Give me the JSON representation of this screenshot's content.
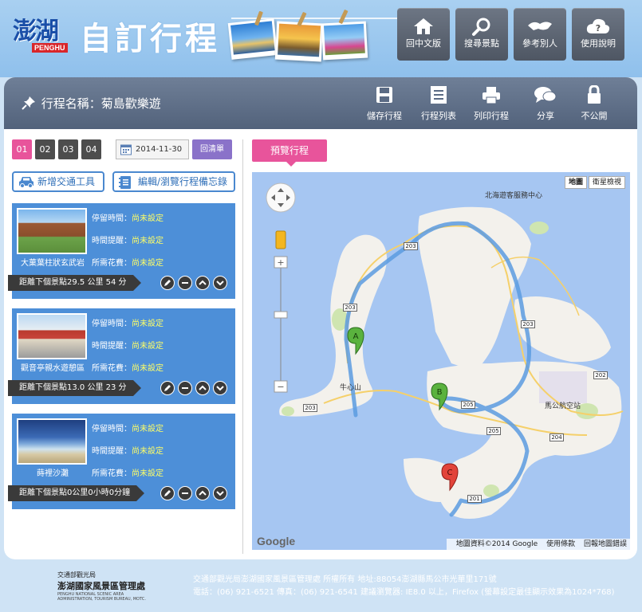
{
  "header": {
    "logo_cn": "澎湖",
    "logo_en": "PENGHU",
    "title": "自訂行程",
    "nav": [
      {
        "label": "回中文版",
        "icon": "home-icon"
      },
      {
        "label": "搜尋景點",
        "icon": "search-icon"
      },
      {
        "label": "參考別人",
        "icon": "handshake-icon"
      },
      {
        "label": "使用說明",
        "icon": "help-cloud-icon"
      }
    ]
  },
  "toolbar": {
    "trip_name": "行程名稱：菊島歡樂遊",
    "actions": [
      {
        "label": "儲存行程",
        "icon": "save-icon"
      },
      {
        "label": "行程列表",
        "icon": "list-icon"
      },
      {
        "label": "列印行程",
        "icon": "print-icon"
      },
      {
        "label": "分享",
        "icon": "share-icon"
      },
      {
        "label": "不公開",
        "icon": "lock-icon"
      }
    ]
  },
  "planner": {
    "days": [
      "01",
      "02",
      "03",
      "04"
    ],
    "active_day": "01",
    "date": "2014-11-30",
    "reset_label": "回清單",
    "add_transport": "新增交通工具",
    "edit_memo": "編輯/瀏覽行程備忘錄",
    "field_labels": {
      "stay": "停留時間：",
      "reminder": "時間提醒：",
      "cost": "所需花費："
    },
    "stops": [
      {
        "name": "大菓葉柱狀玄武岩",
        "stay": "尚未設定",
        "reminder": "尚未設定",
        "cost": "尚未設定",
        "distance": "距離下個景點29.5 公里 54 分"
      },
      {
        "name": "觀音亭親水遊憩區",
        "stay": "尚未設定",
        "reminder": "尚未設定",
        "cost": "尚未設定",
        "distance": "距離下個景點13.0 公里 23 分"
      },
      {
        "name": "蒔裡沙灘",
        "stay": "尚未設定",
        "reminder": "尚未設定",
        "cost": "尚未設定",
        "distance": "距離下個景點0公里0小時0分鐘"
      }
    ]
  },
  "map": {
    "preview_label": "預覽行程",
    "map_type_map": "地圖",
    "map_type_satellite": "衛星檢視",
    "places": {
      "service_center": "北海遊客服務中心",
      "cow_mountain": "牛心山",
      "airport": "馬公航空站"
    },
    "roads": [
      "203",
      "203",
      "203",
      "203",
      "205",
      "205",
      "204",
      "202",
      "201"
    ],
    "markers": [
      "A",
      "B",
      "C"
    ],
    "google": "Google",
    "attribution": "地圖資料©2014 Google",
    "terms": "使用條款",
    "report": "回報地圖錯誤"
  },
  "footer": {
    "agency_line1": "交通部觀光局",
    "agency_name": "澎湖國家風景區管理處",
    "agency_en": "PENGHU NATIONAL SCENIC AREA ADMINISTRATION, TOURISM BUREAU, MOTC.",
    "line1": "交通部觀光局澎湖國家風景區管理處 所權所有 地址:88054澎湖縣馬公市光華里171號",
    "line2": "電話：(06) 921-6521 傳真：(06) 921-6541 建議瀏覽器: IE8.0 以上，Firefox (螢幕設定最佳顯示效果為1024*768)"
  }
}
